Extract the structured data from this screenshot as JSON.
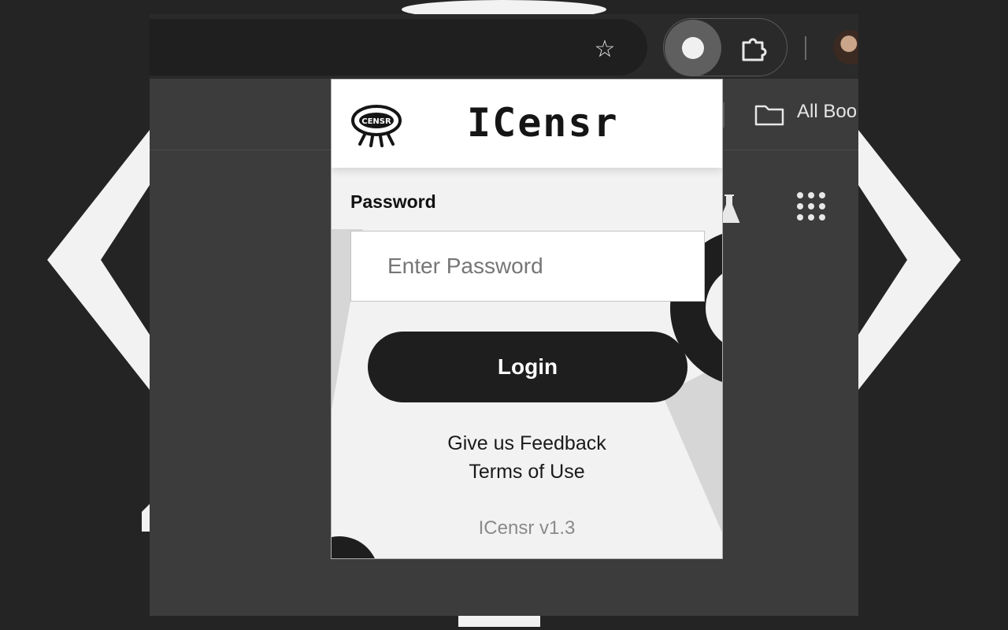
{
  "browser": {
    "bookmarks_label": "All Boo",
    "icons": [
      "star-icon",
      "icensr-extension-icon",
      "puzzle-icon",
      "avatar",
      "folder-icon",
      "flask-icon",
      "apps-grid-icon"
    ]
  },
  "popup": {
    "brand": {
      "logo_text": "CENSR",
      "title": "ICensr"
    },
    "password_label": "Password",
    "password_placeholder": "Enter Password",
    "login_label": "Login",
    "feedback_link": "Give us Feedback",
    "terms_link": "Terms of Use",
    "version": "ICensr v1.3"
  },
  "colors": {
    "page_background": "#242424",
    "popup_background": "#f2f2f2",
    "button": "#1e1e1e",
    "button_text": "#ffffff"
  }
}
